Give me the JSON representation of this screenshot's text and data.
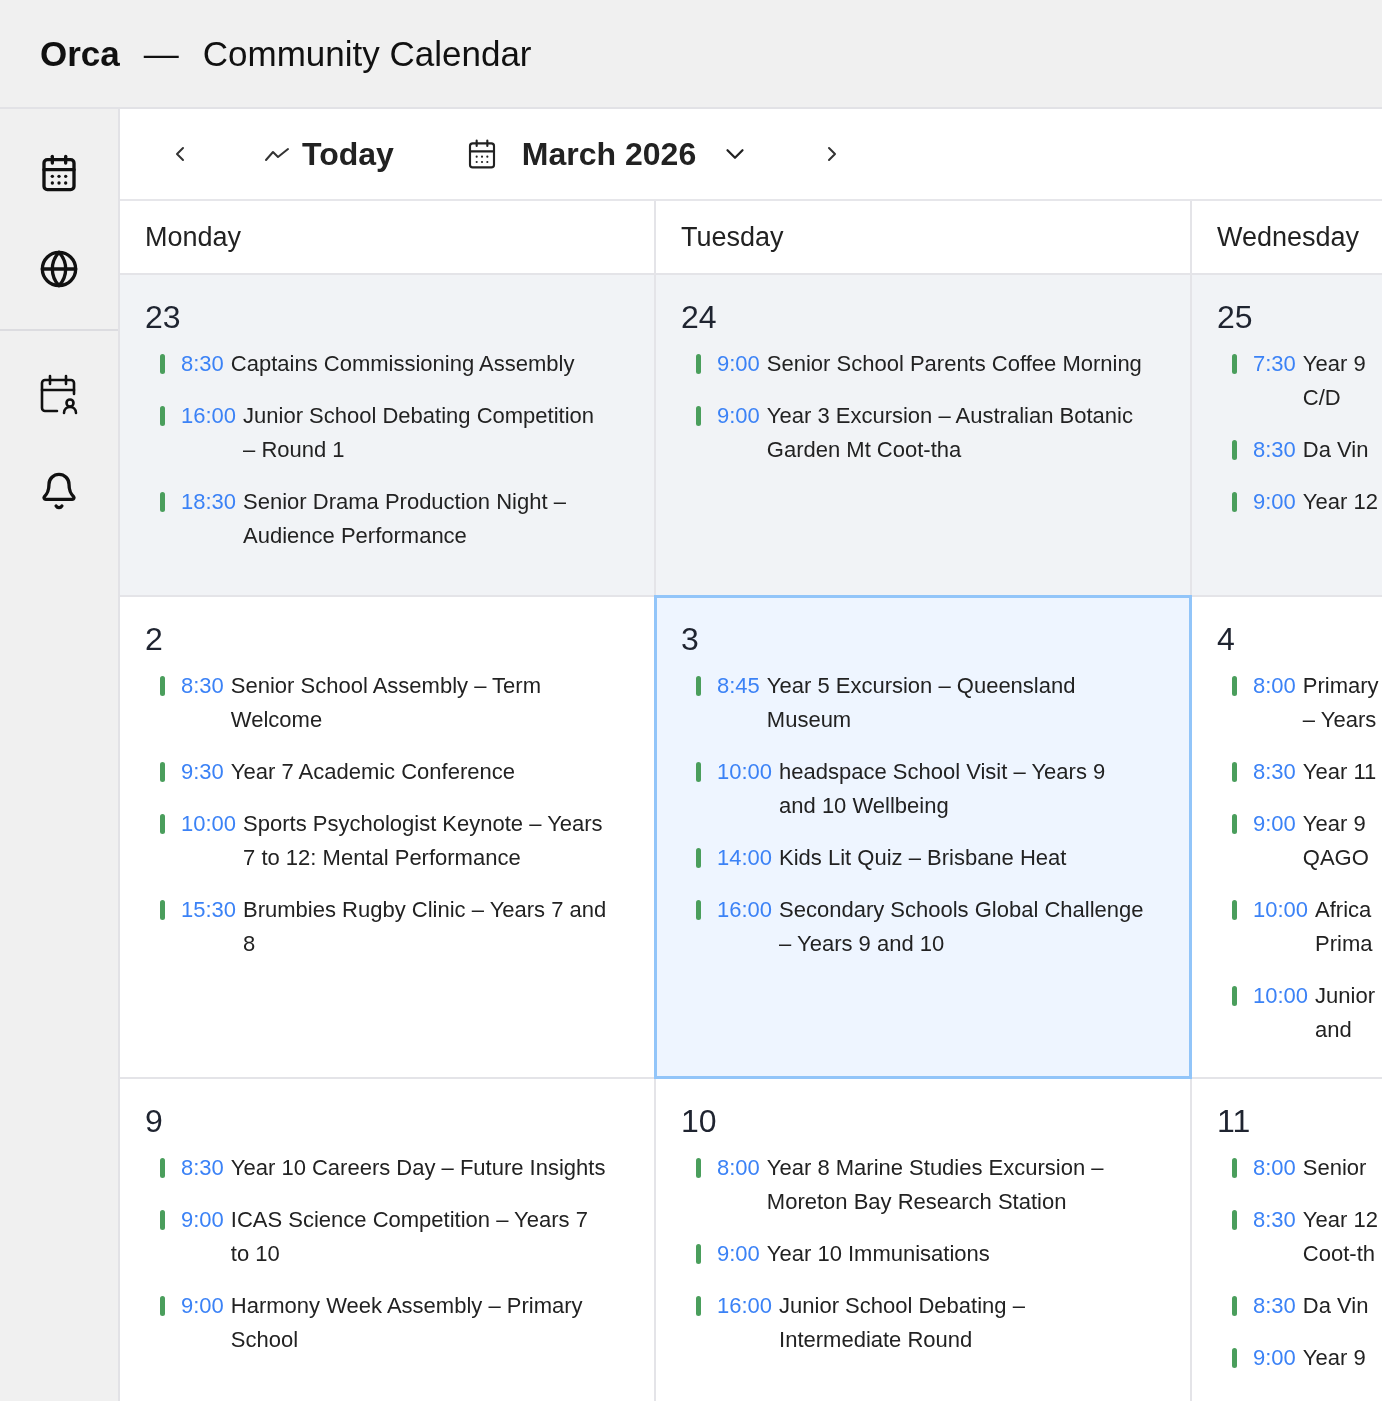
{
  "app": {
    "name": "Orca",
    "separator": "—",
    "title": "Community Calendar"
  },
  "toolbar": {
    "today": "Today",
    "month": "March 2026"
  },
  "weekdays": [
    "Monday",
    "Tuesday",
    "Wednesday"
  ],
  "weeks": [
    {
      "days": [
        {
          "date": "23",
          "past": true,
          "selected": false,
          "events": [
            {
              "time": "8:30",
              "title": "Captains Commissioning Assembly"
            },
            {
              "time": "16:00",
              "title": "Junior School Debating Competition – Round 1"
            },
            {
              "time": "18:30",
              "title": "Senior Drama Production Night – Audience Performance"
            }
          ]
        },
        {
          "date": "24",
          "past": true,
          "selected": false,
          "events": [
            {
              "time": "9:00",
              "title": "Senior School Parents Coffee Morning"
            },
            {
              "time": "9:00",
              "title": "Year 3 Excursion – Australian Botanic Garden Mt Coot-tha"
            }
          ]
        },
        {
          "date": "25",
          "past": true,
          "selected": false,
          "events": [
            {
              "time": "7:30",
              "title": "Year 9\nC/D"
            },
            {
              "time": "8:30",
              "title": "Da Vin"
            },
            {
              "time": "9:00",
              "title": "Year 12"
            }
          ]
        }
      ]
    },
    {
      "days": [
        {
          "date": "2",
          "past": false,
          "selected": false,
          "events": [
            {
              "time": "8:30",
              "title": "Senior School Assembly – Term Welcome"
            },
            {
              "time": "9:30",
              "title": "Year 7 Academic Conference"
            },
            {
              "time": "10:00",
              "title": "Sports Psychologist Keynote – Years 7 to 12: Mental Performance"
            },
            {
              "time": "15:30",
              "title": "Brumbies Rugby Clinic – Years 7 and 8"
            }
          ]
        },
        {
          "date": "3",
          "past": false,
          "selected": true,
          "events": [
            {
              "time": "8:45",
              "title": "Year 5 Excursion – Queensland Museum"
            },
            {
              "time": "10:00",
              "title": "headspace School Visit – Years 9 and 10 Wellbeing"
            },
            {
              "time": "14:00",
              "title": "Kids Lit Quiz – Brisbane Heat"
            },
            {
              "time": "16:00",
              "title": "Secondary Schools Global Challenge – Years 9 and 10"
            }
          ]
        },
        {
          "date": "4",
          "past": false,
          "selected": false,
          "events": [
            {
              "time": "8:00",
              "title": "Primary\n– Years"
            },
            {
              "time": "8:30",
              "title": "Year 11"
            },
            {
              "time": "9:00",
              "title": "Year 9\nQAGO"
            },
            {
              "time": "10:00",
              "title": "Africa\nPrima"
            },
            {
              "time": "10:00",
              "title": "Junior\nand"
            }
          ]
        }
      ]
    },
    {
      "days": [
        {
          "date": "9",
          "past": false,
          "selected": false,
          "events": [
            {
              "time": "8:30",
              "title": "Year 10 Careers Day – Future Insights"
            },
            {
              "time": "9:00",
              "title": "ICAS Science Competition – Years 7 to 10"
            },
            {
              "time": "9:00",
              "title": "Harmony Week Assembly – Primary School"
            }
          ]
        },
        {
          "date": "10",
          "past": false,
          "selected": false,
          "events": [
            {
              "time": "8:00",
              "title": "Year 8 Marine Studies Excursion – Moreton Bay Research Station"
            },
            {
              "time": "9:00",
              "title": "Year 10 Immunisations"
            },
            {
              "time": "16:00",
              "title": "Junior School Debating – Intermediate Round"
            }
          ]
        },
        {
          "date": "11",
          "past": false,
          "selected": false,
          "events": [
            {
              "time": "8:00",
              "title": "Senior"
            },
            {
              "time": "8:30",
              "title": "Year 12\nCoot-th"
            },
            {
              "time": "8:30",
              "title": "Da Vin"
            },
            {
              "time": "9:00",
              "title": "Year 9"
            }
          ]
        }
      ]
    }
  ]
}
